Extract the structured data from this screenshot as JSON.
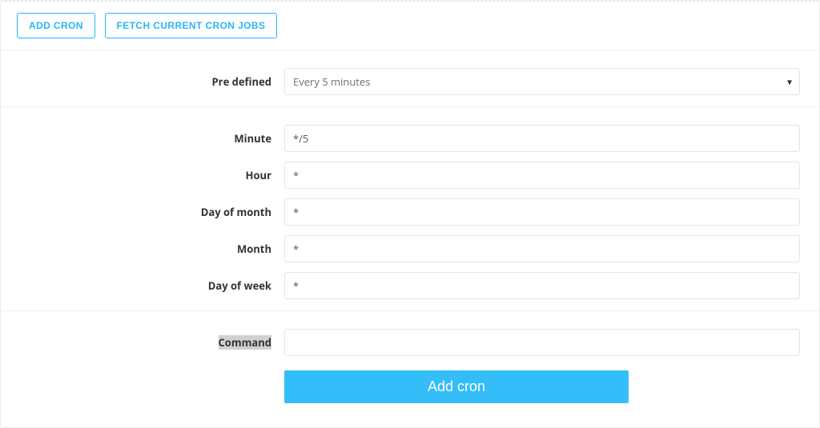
{
  "toolbar": {
    "add_cron_label": "ADD CRON",
    "fetch_label": "FETCH CURRENT CRON JOBS"
  },
  "form": {
    "predefined": {
      "label": "Pre defined",
      "selected": "Every 5 minutes"
    },
    "minute": {
      "label": "Minute",
      "value": "*/5"
    },
    "hour": {
      "label": "Hour",
      "value": "*"
    },
    "dom": {
      "label": "Day of month",
      "value": "*"
    },
    "month": {
      "label": "Month",
      "value": "*"
    },
    "dow": {
      "label": "Day of week",
      "value": "*"
    },
    "command": {
      "label": "Command",
      "value": ""
    }
  },
  "submit": {
    "label": "Add cron"
  },
  "colors": {
    "accent": "#29b6f6",
    "primary_button": "#33bdf9"
  }
}
